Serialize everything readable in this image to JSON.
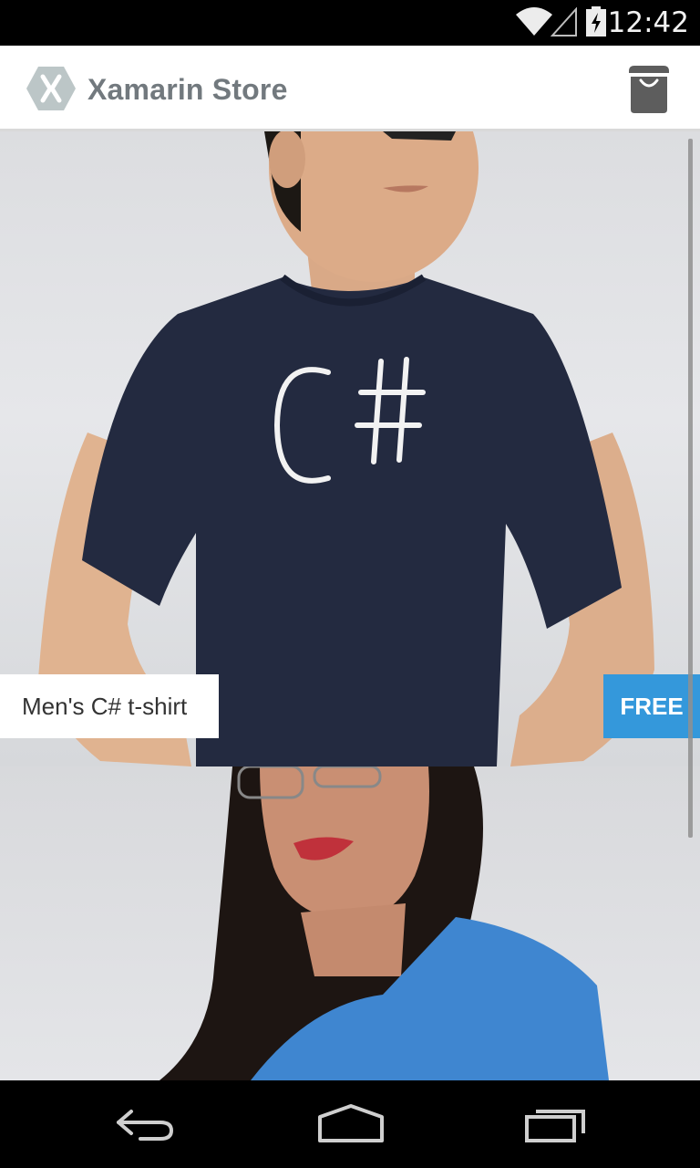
{
  "status_bar": {
    "time": "12:42",
    "icons": [
      "wifi-icon",
      "cell-signal-icon",
      "battery-charging-icon"
    ]
  },
  "app_bar": {
    "title": "Xamarin Store",
    "logo_icon": "xamarin-hexagon-logo",
    "cart_icon": "shopping-bag-icon"
  },
  "products": [
    {
      "name": "Men's C# t-shirt",
      "price": "FREE",
      "shirt_print": "C#",
      "shirt_color": "#232a40"
    },
    {
      "name": "",
      "price": "",
      "shirt_color": "#3f86d0"
    }
  ],
  "colors": {
    "price_badge": "#3498db",
    "title_text": "#72797e"
  },
  "nav_bar": {
    "buttons": [
      "back-icon",
      "home-icon",
      "recent-apps-icon"
    ]
  }
}
